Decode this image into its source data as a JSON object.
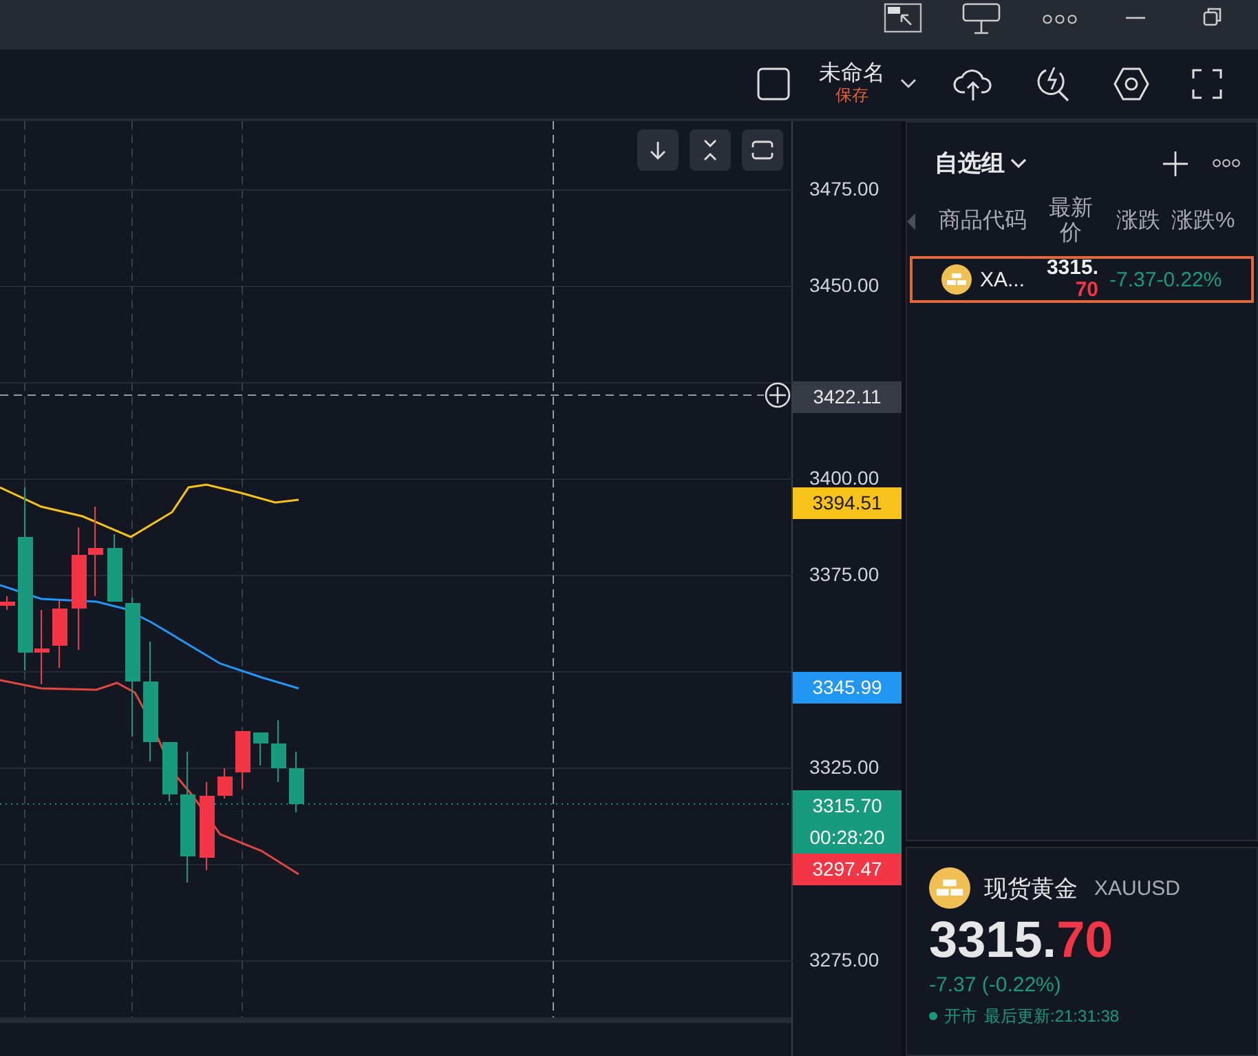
{
  "toolbar": {
    "layout_name": "未命名",
    "save_label": "保存"
  },
  "chart": {
    "axis_ticks": [
      "3475.00",
      "3450.00",
      "3400.00",
      "3375.00",
      "3325.00",
      "3275.00"
    ],
    "price_tags": [
      {
        "label": "3422.11",
        "kind": "crosshair",
        "color": "#363a45"
      },
      {
        "label": "3394.51",
        "kind": "indicator",
        "color": "#f7c21a"
      },
      {
        "label": "3345.99",
        "kind": "indicator",
        "color": "#2196f3"
      },
      {
        "label": "3315.70",
        "kind": "last",
        "color": "#179a7e"
      },
      {
        "label": "00:28:20",
        "kind": "countdown",
        "color": "#179a7e"
      },
      {
        "label": "3297.47",
        "kind": "indicator",
        "color": "#f23645"
      }
    ]
  },
  "watchlist": {
    "title": "自选组",
    "columns": [
      "商品代码",
      "最新价",
      "涨跌",
      "涨跌%"
    ],
    "rows": [
      {
        "symbol": "XA...",
        "price_main": "3315.",
        "price_decimal": "70",
        "change": "-7.37",
        "change_pct": "-0.22%",
        "selected": true
      }
    ]
  },
  "detail": {
    "name": "现货黄金",
    "symbol": "XAUUSD",
    "price_main": "3315.",
    "price_decimal": "70",
    "change": "-7.37 (-0.22%)",
    "market_status": "开市",
    "last_update": "最后更新:21:31:38"
  }
}
